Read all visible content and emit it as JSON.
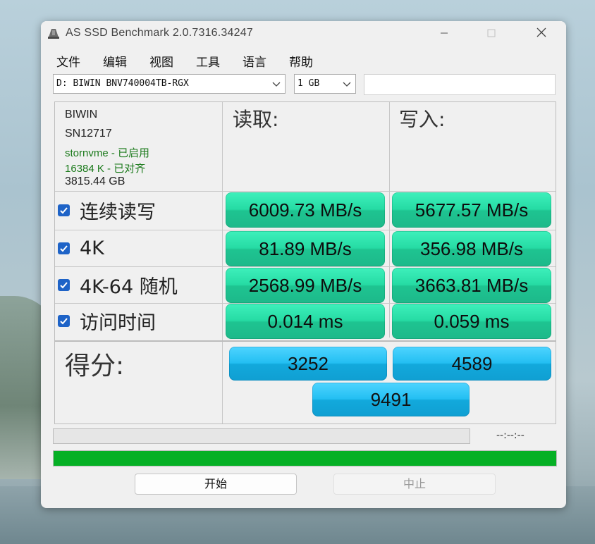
{
  "window": {
    "title": "AS SSD Benchmark 2.0.7316.34247"
  },
  "menu": [
    "文件",
    "编辑",
    "视图",
    "工具",
    "语言",
    "帮助"
  ],
  "drive_select": {
    "value": "D: BIWIN BNV740004TB-RGX"
  },
  "size_select": {
    "value": "1 GB"
  },
  "drive_info": {
    "brand": "BIWIN",
    "firmware": "SN12717",
    "driver": "stornvme - 已启用",
    "alignment": "16384 K - 已对齐",
    "capacity": "3815.44 GB"
  },
  "headers": {
    "read": "读取:",
    "write": "写入:"
  },
  "tests": [
    {
      "label": "连续读写",
      "read": "6009.73 MB/s",
      "write": "5677.57 MB/s"
    },
    {
      "label": "4K",
      "read": "81.89 MB/s",
      "write": "356.98 MB/s"
    },
    {
      "label": "4K-64 随机",
      "read": "2568.99 MB/s",
      "write": "3663.81 MB/s"
    },
    {
      "label": "访问时间",
      "read": "0.014 ms",
      "write": "0.059 ms"
    }
  ],
  "score": {
    "label": "得分:",
    "read": "3252",
    "write": "4589",
    "total": "9491"
  },
  "progress": {
    "time": "--:--:--",
    "overall_fraction": 1.0
  },
  "buttons": {
    "start": "开始",
    "stop": "中止"
  },
  "colors": {
    "result_green": "#26dba4",
    "score_blue": "#23bff2",
    "progress_green": "#06b025",
    "checkbox_blue": "#1e63c7"
  }
}
